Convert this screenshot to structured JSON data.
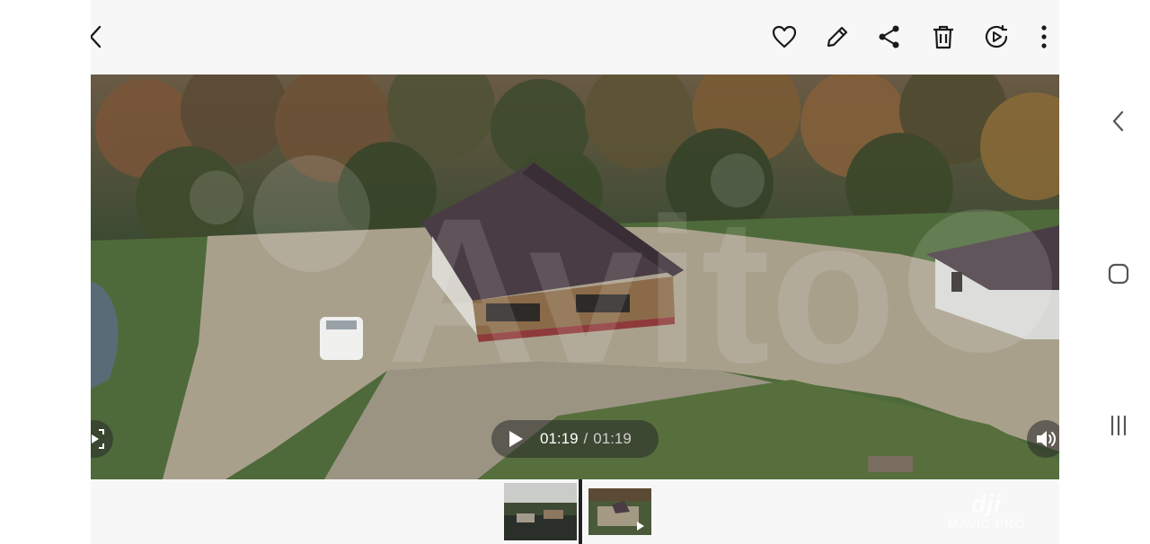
{
  "topbar": {
    "icons": [
      "back-arrow-icon",
      "heart-icon",
      "pencil-edit-icon",
      "share-icon",
      "trash-icon",
      "video-editor-icon",
      "more-vertical-icon"
    ]
  },
  "player": {
    "current_time": "01:19",
    "separator": "/",
    "total_time": "01:19",
    "progress": 1.0
  },
  "overlay_watermark": {
    "text": "Avito"
  },
  "filmstrip": {
    "thumbnails": [
      {
        "type": "image",
        "selected": true
      },
      {
        "type": "video",
        "selected": false
      }
    ]
  },
  "camera_watermark": {
    "logo": "dji",
    "model": "MAVIC PRO"
  },
  "system_nav": {
    "icons": [
      "chevron-left-icon",
      "home-square-icon",
      "recents-bars-icon"
    ]
  },
  "colors": {
    "background": "#f7f7f7",
    "icon": "#1a1a1a",
    "overlay": "#282828",
    "roof": "#4a3c44",
    "grass": "#4f6a3a"
  }
}
